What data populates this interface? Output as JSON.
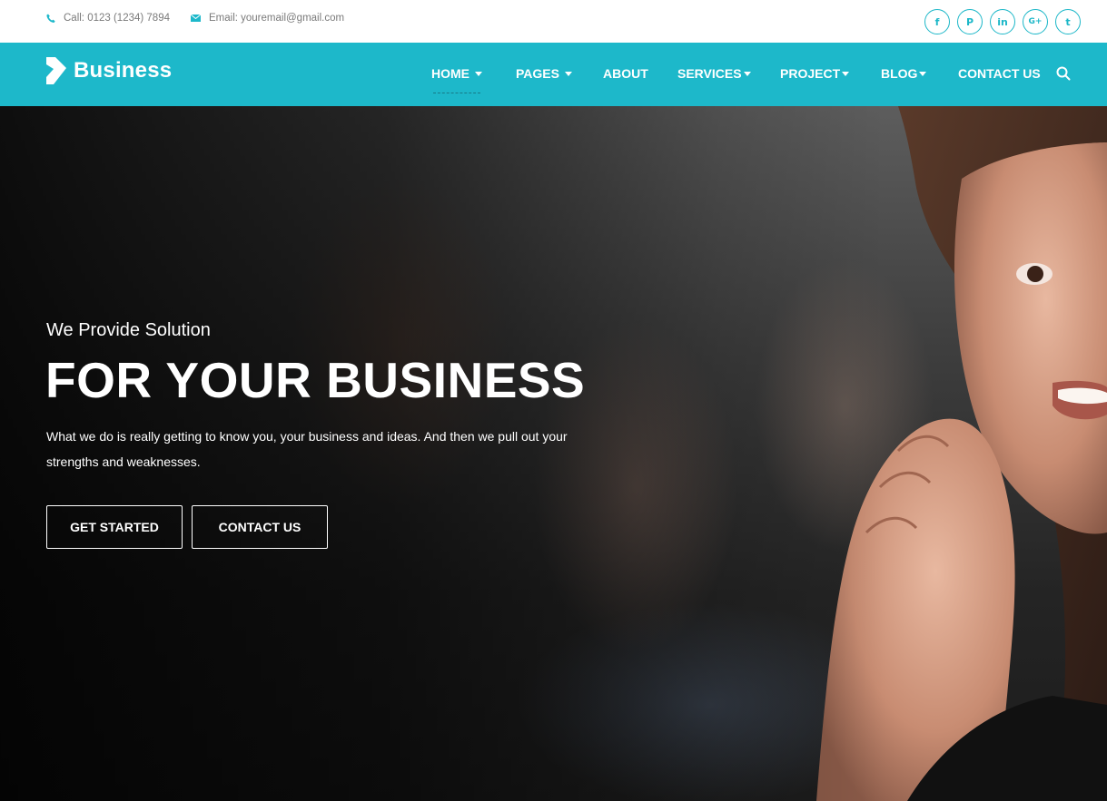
{
  "topbar": {
    "phone_label": "Call: 0123 (1234) 7894",
    "email_label": "Email: youremail@gmail.com",
    "phone_icon": "phone-icon",
    "email_icon": "envelope-icon",
    "socials": [
      {
        "icon": "facebook-icon",
        "glyph": "f"
      },
      {
        "icon": "pinterest-icon",
        "glyph": "P"
      },
      {
        "icon": "linkedin-icon",
        "glyph": "in"
      },
      {
        "icon": "google-plus-icon",
        "glyph": "G+"
      },
      {
        "icon": "twitter-icon",
        "glyph": "t"
      }
    ]
  },
  "brand": {
    "name": "Business",
    "logo_icon": "chevron-logo-icon"
  },
  "nav": {
    "items": [
      {
        "label": "HOME",
        "dropdown": true,
        "active": true
      },
      {
        "label": "PAGES",
        "dropdown": true
      },
      {
        "label": "ABOUT",
        "dropdown": false
      },
      {
        "label": "SERVICES",
        "dropdown": true
      },
      {
        "label": "PROJECT",
        "dropdown": true
      },
      {
        "label": "BLOG",
        "dropdown": true
      },
      {
        "label": "CONTACT US",
        "dropdown": false
      }
    ],
    "search_icon": "search-icon"
  },
  "hero": {
    "subtitle": "We Provide Solution",
    "title": "FOR YOUR BUSINESS",
    "description": "What we do is really getting to know you, your business and ideas. And then we pull out your strengths and weaknesses.",
    "primary_button": "GET STARTED",
    "secondary_button": "CONTACT US"
  },
  "colors": {
    "accent": "#1db8ca",
    "text_light": "#ffffff",
    "topbar_text": "#7a7a7a"
  }
}
